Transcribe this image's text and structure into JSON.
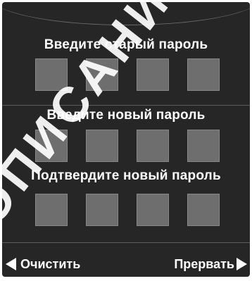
{
  "old_password": {
    "label": "Введите старый пароль",
    "digits": [
      "",
      "",
      "",
      ""
    ]
  },
  "new_password": {
    "label": "Введите новый пароль",
    "digits": [
      "",
      "",
      "",
      ""
    ]
  },
  "confirm_password": {
    "label": "Подтвердите новый пароль",
    "digits": [
      "",
      "",
      "",
      ""
    ]
  },
  "softkeys": {
    "left_label": "Очистить",
    "left_icon": "triangle-left-icon",
    "right_label": "Прервать",
    "right_icon": "triangle-right-icon"
  },
  "watermark": {
    "text": "ОПИСАНИЕ"
  },
  "colors": {
    "background": "#262626",
    "box_fill": "#6e6e6e",
    "text": "#ffffff",
    "watermark": "#ffffff"
  }
}
